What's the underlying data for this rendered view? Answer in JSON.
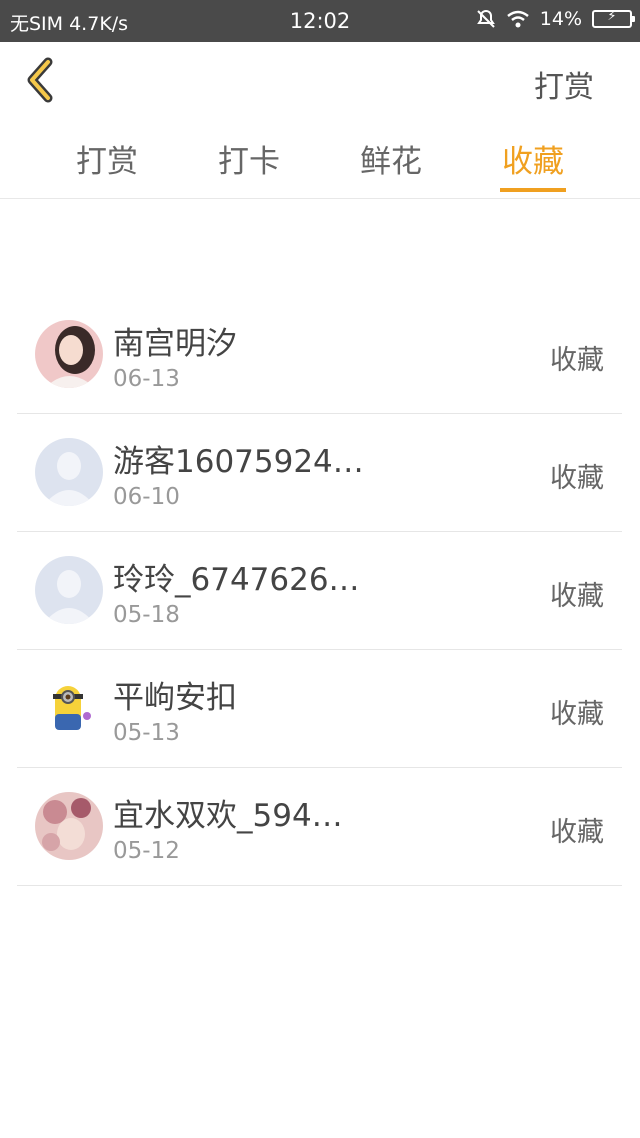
{
  "status_bar": {
    "carrier": "无SIM 4.7K/s",
    "time": "12:02",
    "battery": "14%",
    "icons": [
      "bell-off-icon",
      "wifi-icon",
      "battery-charging-icon"
    ]
  },
  "nav": {
    "back_icon": "chevron-left-icon",
    "action_label": "打赏",
    "accent_color": "#f0a020"
  },
  "tabs": [
    {
      "label": "打赏",
      "active": false
    },
    {
      "label": "打卡",
      "active": false
    },
    {
      "label": "鲜花",
      "active": false
    },
    {
      "label": "收藏",
      "active": true
    }
  ],
  "list": [
    {
      "name": "南宫明汐",
      "date": "06-13",
      "action": "收藏",
      "avatar": "photo-woman-avatar"
    },
    {
      "name": "游客16075924…",
      "date": "06-10",
      "action": "收藏",
      "avatar": "default-person-avatar"
    },
    {
      "name": "玲玲_6747626…",
      "date": "05-18",
      "action": "收藏",
      "avatar": "default-person-avatar"
    },
    {
      "name": "平岣安扣",
      "date": "05-13",
      "action": "收藏",
      "avatar": "minion-avatar"
    },
    {
      "name": "宜水双欢_594…",
      "date": "05-12",
      "action": "收藏",
      "avatar": "photo-flowers-avatar"
    }
  ]
}
